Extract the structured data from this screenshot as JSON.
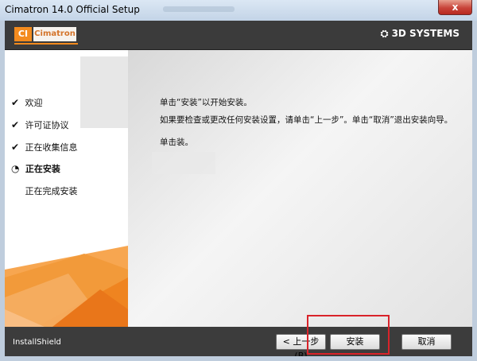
{
  "window": {
    "title": "Cimatron 14.0  Official Setup",
    "close_label": "x"
  },
  "header": {
    "logo_ci": "CI",
    "logo_text": "Cimatron",
    "brand": "3D SYSTEMS"
  },
  "steps": [
    {
      "label": "欢迎",
      "state": "done",
      "icon": "checkmark-icon",
      "symbol": "✔"
    },
    {
      "label": "许可证协议",
      "state": "done",
      "icon": "checkmark-icon",
      "symbol": "✔"
    },
    {
      "label": "正在收集信息",
      "state": "done",
      "icon": "checkmark-icon",
      "symbol": "✔"
    },
    {
      "label": "正在安装",
      "state": "current",
      "icon": "progress-ring-icon",
      "symbol": "◔"
    },
    {
      "label": "正在完成安装",
      "state": "pending",
      "icon": "",
      "symbol": ""
    }
  ],
  "main": {
    "line1": "单击“安装”以开始安装。",
    "line2": "如果要检查或更改任何安装设置，请单击“上一步”。单击“取消”退出安装向导。",
    "line3": "单击装。"
  },
  "footer": {
    "installshield": "InstallShield",
    "back_label": "< 上一步(B)",
    "install_label": "安装",
    "cancel_label": "取消"
  },
  "colors": {
    "accent_orange": "#f38b1e",
    "highlight_red": "#d9232a",
    "header_dark": "#3b3b3b"
  }
}
